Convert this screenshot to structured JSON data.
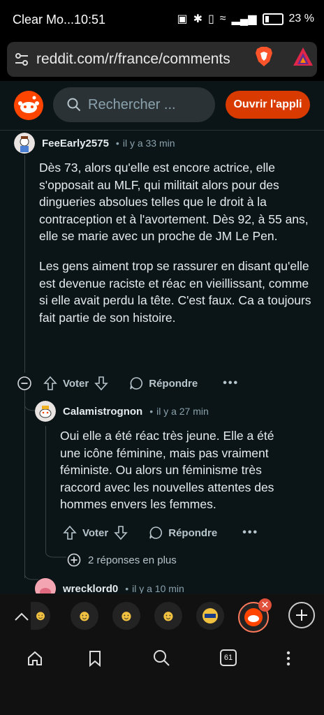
{
  "status_bar": {
    "carrier": "Clear Mo...",
    "time": "10:51",
    "battery": "23 %"
  },
  "browser": {
    "url": "reddit.com/r/france/comments"
  },
  "reddit_header": {
    "search_placeholder": "Rechercher ...",
    "open_app": "Ouvrir l'appli"
  },
  "comments": [
    {
      "author": "FeeEarly2575",
      "time": "il y a 33 min",
      "paragraphs": [
        "Dès 73, alors qu'elle est encore actrice, elle s'opposait au MLF, qui militait alors pour des dingueries absolues telles que le droit à la contraception et à l'avortement. Dès 92, à 55 ans, elle se marie avec un proche de JM Le Pen.",
        "Les gens aiment trop se rassurer en disant qu'elle est devenue raciste et réac en vieillissant, comme si elle avait perdu la tête. C'est faux. Ca a toujours fait partie de son histoire."
      ],
      "vote_label": "Voter",
      "reply_label": "Répondre"
    },
    {
      "author": "Calamistrognon",
      "time": "il y a 27 min",
      "paragraphs": [
        "Oui elle a été réac très jeune. Elle a été une icône féminine, mais pas vraiment féministe. Ou alors un féminisme très raccord avec les nouvelles attentes des hommes envers les femmes."
      ],
      "vote_label": "Voter",
      "reply_label": "Répondre",
      "more_replies": "2 réponses en plus"
    },
    {
      "author": "wrecklord0",
      "time": "il y a 10 min"
    }
  ],
  "bottom_nav": {
    "tab_count": "61"
  },
  "colors": {
    "accent": "#d93a00",
    "background": "#0b1416"
  }
}
